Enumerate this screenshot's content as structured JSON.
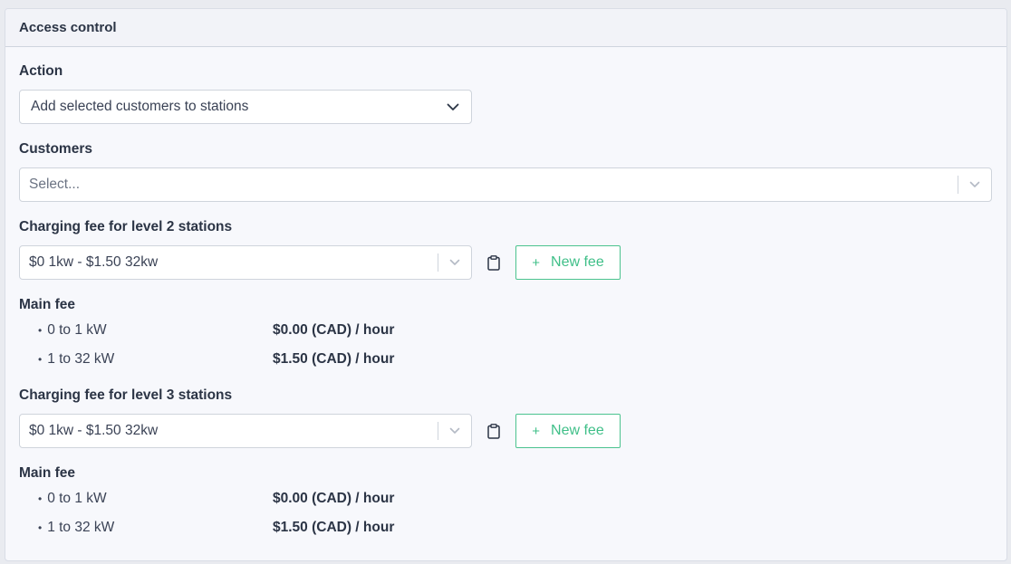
{
  "card": {
    "title": "Access control"
  },
  "action": {
    "label": "Action",
    "selected": "Add selected customers to stations"
  },
  "customers": {
    "label": "Customers",
    "placeholder": "Select..."
  },
  "level2": {
    "label": "Charging fee for level 2 stations",
    "selected": "$0 1kw - $1.50 32kw",
    "new_fee_label": "New fee",
    "main_fee_label": "Main fee",
    "rows": [
      {
        "range": "0 to 1 kW",
        "amount": "$0.00 (CAD) / hour"
      },
      {
        "range": "1 to 32 kW",
        "amount": "$1.50 (CAD) / hour"
      }
    ]
  },
  "level3": {
    "label": "Charging fee for level 3 stations",
    "selected": "$0 1kw - $1.50 32kw",
    "new_fee_label": "New fee",
    "main_fee_label": "Main fee",
    "rows": [
      {
        "range": "0 to 1 kW",
        "amount": "$0.00 (CAD) / hour"
      },
      {
        "range": "1 to 32 kW",
        "amount": "$1.50 (CAD) / hour"
      }
    ]
  },
  "icons": {
    "chevron": "chevron-down-icon",
    "clipboard": "clipboard-icon",
    "plus": "plus-icon"
  },
  "colors": {
    "accent_green": "#3fbf88",
    "panel_bg": "#f7f8fc",
    "text_dark": "#2b3445"
  }
}
